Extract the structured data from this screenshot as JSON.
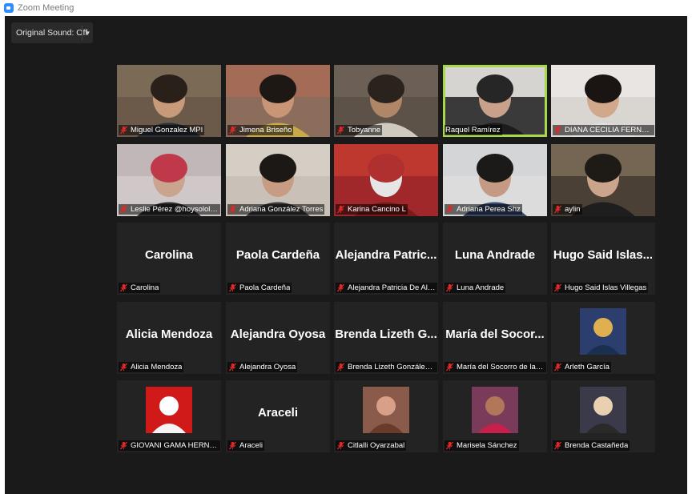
{
  "window": {
    "title": "Zoom Meeting"
  },
  "toolbar": {
    "original_sound_label": "Original Sound: Off",
    "dropdown_icon": "caret-down-icon"
  },
  "colors": {
    "active_speaker_border": "#a8d84a",
    "muted_mic": "#e02828",
    "background": "#1a1a1a",
    "tile": "#232323"
  },
  "participants": [
    {
      "label": "Miguel Gonzalez MPI",
      "kind": "video",
      "muted": true
    },
    {
      "label": "Jimena Briseño",
      "kind": "video",
      "muted": true
    },
    {
      "label": "Tobyanne",
      "kind": "video",
      "muted": true
    },
    {
      "label": "Raquel Ramírez",
      "kind": "video",
      "muted": false,
      "active_speaker": true
    },
    {
      "label": "DIANA CECILIA FERNÁND...",
      "kind": "video",
      "muted": true
    },
    {
      "label": "Leslie Pérez @hoysololesi...",
      "kind": "video",
      "muted": true
    },
    {
      "label": "Adriana González Torres",
      "kind": "video",
      "muted": true
    },
    {
      "label": "Karina Cancino L",
      "kind": "video",
      "muted": true
    },
    {
      "label": "Adriana Perea Shz",
      "kind": "video",
      "muted": true
    },
    {
      "label": "aylin",
      "kind": "video",
      "muted": true
    },
    {
      "display_name": "Carolina",
      "label": "Carolina",
      "kind": "name",
      "muted": true
    },
    {
      "display_name": "Paola Cardeña",
      "label": "Paola Cardeña",
      "kind": "name",
      "muted": true
    },
    {
      "display_name": "Alejandra Patric...",
      "label": "Alejandra Patricia De Alb...",
      "kind": "name",
      "muted": true
    },
    {
      "display_name": "Luna Andrade",
      "label": "Luna Andrade",
      "kind": "name",
      "muted": true
    },
    {
      "display_name": "Hugo Said Islas...",
      "label": "Hugo Said Islas Villegas",
      "kind": "name",
      "muted": true
    },
    {
      "display_name": "Alicia Mendoza",
      "label": "Alicia Mendoza",
      "kind": "name",
      "muted": true
    },
    {
      "display_name": "Alejandra Oyosa",
      "label": "Alejandra Oyosa",
      "kind": "name",
      "muted": true
    },
    {
      "display_name": "Brenda Lizeth G...",
      "label": "Brenda Lizeth González A...",
      "kind": "name",
      "muted": true
    },
    {
      "display_name": "María del Socor...",
      "label": "María del Socorro de la G...",
      "kind": "name",
      "muted": true
    },
    {
      "label": "Arleth García",
      "kind": "picture",
      "muted": true
    },
    {
      "label": "GIOVANI GAMA HERNAN...",
      "kind": "picture",
      "muted": true
    },
    {
      "display_name": "Araceli",
      "label": "Araceli",
      "kind": "name",
      "muted": true
    },
    {
      "label": "Citlalli Oyarzabal",
      "kind": "picture",
      "muted": true
    },
    {
      "label": "Marisela Sánchez",
      "kind": "picture",
      "muted": true
    },
    {
      "label": "Brenda Castañeda",
      "kind": "picture",
      "muted": true
    }
  ]
}
